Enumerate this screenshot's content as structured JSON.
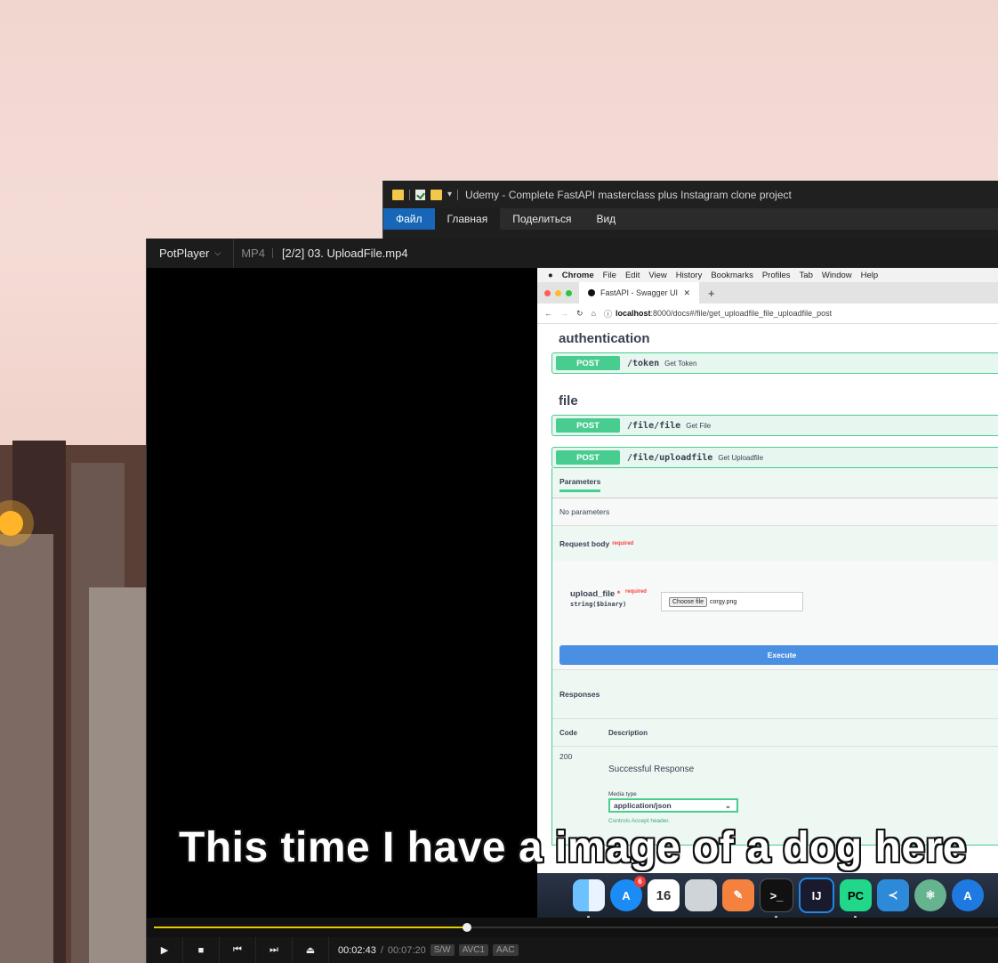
{
  "explorer": {
    "title": "Udemy - Complete FastAPI masterclass plus Instagram clone project",
    "ribbon_tabs": [
      "Файл",
      "Главная",
      "Поделиться",
      "Вид"
    ]
  },
  "player": {
    "app_name": "PotPlayer",
    "format": "MP4",
    "file_title": "[2/2] 03. UploadFile.mp4",
    "subtitle": "This time I have a image of a dog here",
    "time_current": "00:02:43",
    "time_total": "00:07:20",
    "badges": [
      "S/W",
      "AVC1",
      "AAC"
    ],
    "progress_fraction": 0.3705,
    "accent": "#e8c800"
  },
  "mac": {
    "menu": [
      "Chrome",
      "File",
      "Edit",
      "View",
      "History",
      "Bookmarks",
      "Profiles",
      "Tab",
      "Window",
      "Help"
    ],
    "tab_title": "FastAPI - Swagger UI",
    "url_host": "localhost",
    "url_rest": ":8000/docs#/file/get_uploadfile_file_uploadfile_post",
    "dock_icons": [
      "finder-icon",
      "app-store-icon",
      "calendar-icon",
      "script-editor-icon",
      "swift-icon",
      "terminal-icon",
      "intellij-icon",
      "pycharm-icon",
      "vscode-icon",
      "atom-icon",
      "xcode-instruments-icon"
    ],
    "calendar_day": "16",
    "appstore_badge": "6"
  },
  "swagger": {
    "section_auth": "authentication",
    "section_file": "file",
    "ops": [
      {
        "method": "POST",
        "path": "/token",
        "summary": "Get Token"
      },
      {
        "method": "POST",
        "path": "/file/file",
        "summary": "Get File"
      },
      {
        "method": "POST",
        "path": "/file/uploadfile",
        "summary": "Get Uploadfile"
      }
    ],
    "parameters_tab": "Parameters",
    "no_parameters": "No parameters",
    "request_body": "Request body",
    "required": "required",
    "field_name": "upload_file",
    "field_asterisk": "*",
    "field_type": "string($binary)",
    "choose_file": "Choose file",
    "chosen_file": "corgy.png",
    "execute": "Execute",
    "responses": "Responses",
    "col_code": "Code",
    "col_description": "Description",
    "code_200": "200",
    "success": "Successful Response",
    "media_type_label": "Media type",
    "media_type_value": "application/json",
    "controls_accept": "Controls Accept header."
  }
}
